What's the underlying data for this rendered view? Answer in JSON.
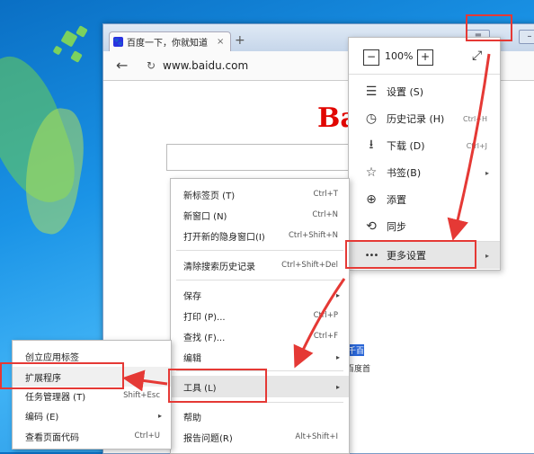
{
  "tab": {
    "title": "百度一下，你就知道",
    "close": "×",
    "new_tab": "+"
  },
  "address": {
    "back": "←",
    "reload": "↻",
    "url": "www.baidu.com"
  },
  "page": {
    "logo": "Bai",
    "hot1": "千百",
    "hot2": "百度首"
  },
  "window": {
    "minimize": "–",
    "menu": "≡"
  },
  "main_menu": {
    "zoom_minus": "−",
    "zoom_value": "100%",
    "zoom_plus": "+",
    "fullscreen": "⤢",
    "items": [
      {
        "icon": "☰",
        "label": "设置 (S)",
        "shortcut": ""
      },
      {
        "icon": "◷",
        "label": "历史记录 (H)",
        "shortcut": "Ctrl+H"
      },
      {
        "icon": "⭳",
        "label": "下载 (D)",
        "shortcut": "Ctrl+J"
      },
      {
        "icon": "☆",
        "label": "书签(B)",
        "shortcut": "",
        "arrow": "▸"
      },
      {
        "icon": "⊕",
        "label": "添置",
        "shortcut": ""
      },
      {
        "icon": "⟲",
        "label": "同步",
        "shortcut": ""
      },
      {
        "icon": "•••",
        "label": "更多设置",
        "shortcut": "",
        "arrow": "▸"
      }
    ]
  },
  "more_menu": {
    "items": [
      {
        "label": "新标签页 (T)",
        "shortcut": "Ctrl+T"
      },
      {
        "label": "新窗口 (N)",
        "shortcut": "Ctrl+N"
      },
      {
        "label": "打开新的隐身窗口(I)",
        "shortcut": "Ctrl+Shift+N"
      },
      {
        "label": "清除搜索历史记录",
        "shortcut": "Ctrl+Shift+Del"
      },
      {
        "label": "保存",
        "shortcut": "",
        "arrow": "▸"
      },
      {
        "label": "打印 (P)...",
        "shortcut": "Ctrl+P"
      },
      {
        "label": "查找 (F)...",
        "shortcut": "Ctrl+F"
      },
      {
        "label": "编辑",
        "shortcut": "",
        "arrow": "▸"
      },
      {
        "label": "工具 (L)",
        "shortcut": "",
        "arrow": "▸"
      },
      {
        "label": "帮助",
        "shortcut": ""
      },
      {
        "label": "报告问题(R)",
        "shortcut": "Alt+Shift+I"
      }
    ]
  },
  "tools_menu": {
    "items": [
      {
        "label": "创立应用标签",
        "shortcut": ""
      },
      {
        "label": "扩展程序",
        "shortcut": ""
      },
      {
        "label": "任务管理器 (T)",
        "shortcut": "Shift+Esc"
      },
      {
        "label": "编码 (E)",
        "shortcut": "",
        "arrow": "▸"
      },
      {
        "label": "查看页面代码",
        "shortcut": "Ctrl+U"
      }
    ]
  }
}
